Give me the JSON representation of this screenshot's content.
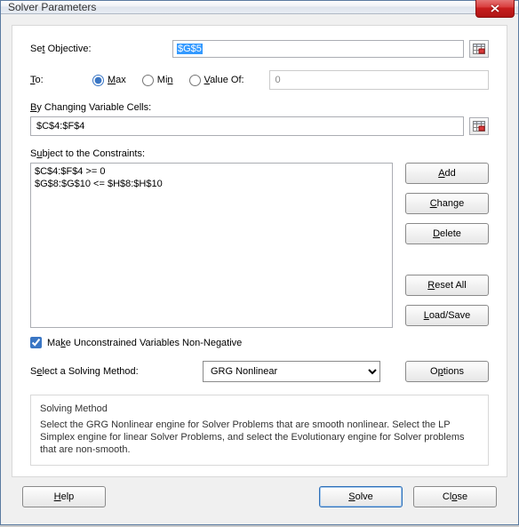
{
  "window": {
    "title": "Solver Parameters"
  },
  "objective": {
    "label_pre": "Se",
    "label_u": "t",
    "label_post": " Objective:",
    "value": "$G$5"
  },
  "to": {
    "label_pre": "",
    "label_u": "T",
    "label_post": "o:",
    "max_u": "M",
    "max_post": "ax",
    "min_pre": "Mi",
    "min_u": "n",
    "valof_u": "V",
    "valof_post": "alue Of:",
    "value": "0",
    "selected": "max"
  },
  "changing": {
    "label_u": "B",
    "label_post": "y Changing Variable Cells:",
    "value": "$C$4:$F$4"
  },
  "constraints": {
    "label_pre": "S",
    "label_u": "u",
    "label_post": "bject to the Constraints:",
    "lines": [
      "$C$4:$F$4 >= 0",
      "$G$8:$G$10 <= $H$8:$H$10"
    ]
  },
  "buttons": {
    "add_u": "A",
    "add_post": "dd",
    "change_u": "C",
    "change_post": "hange",
    "delete_u": "D",
    "delete_post": "elete",
    "reset_u": "R",
    "reset_post": "eset All",
    "loadsave_u": "L",
    "loadsave_post": "oad/Save",
    "options_pre": "O",
    "options_u": "p",
    "options_post": "tions",
    "help_u": "H",
    "help_post": "elp",
    "solve_u": "S",
    "solve_post": "olve",
    "close_pre": "Cl",
    "close_u": "o",
    "close_post": "se"
  },
  "checkbox": {
    "pre": "Ma",
    "u": "k",
    "post": "e Unconstrained Variables Non-Negative",
    "checked": true
  },
  "method": {
    "label_pre": "S",
    "label_u": "e",
    "label_post": "lect a Solving Method:",
    "value": "GRG Nonlinear"
  },
  "description": {
    "title": "Solving Method",
    "body": "Select the GRG Nonlinear engine for Solver Problems that are smooth nonlinear. Select the LP Simplex engine for linear Solver Problems, and select the Evolutionary engine for Solver problems that are non-smooth."
  }
}
